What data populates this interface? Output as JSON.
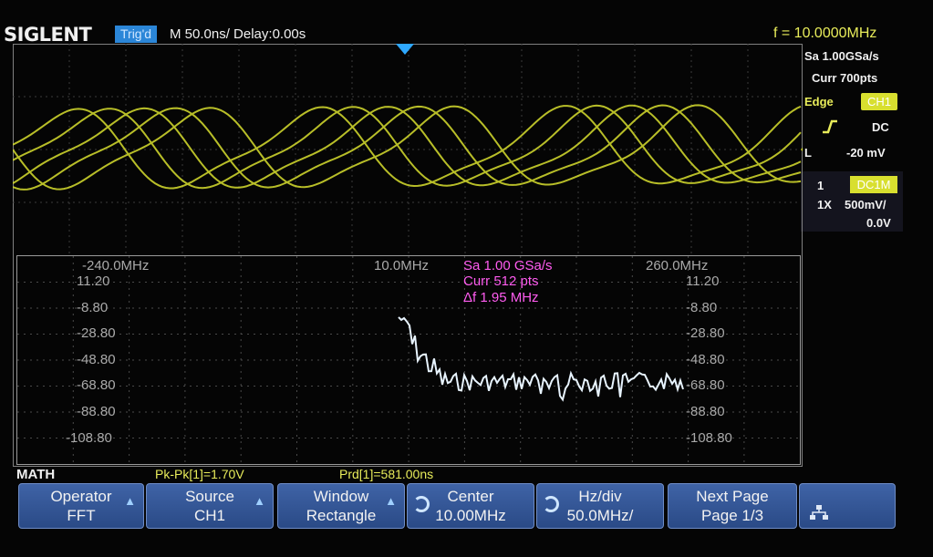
{
  "header": {
    "brand": "SIGLENT",
    "trigger_status": "Trig'd",
    "timebase": "M 50.0ns/",
    "delay": "Delay:0.00s",
    "frequency": "f = 10.0000MHz"
  },
  "acquisition": {
    "sample_rate": "Sa 1.00GSa/s",
    "current_points": "Curr 700pts"
  },
  "trigger": {
    "type": "Edge",
    "source": "CH1",
    "slope_icon": "rising-edge-icon",
    "coupling": "DC",
    "level_label": "L",
    "level_value": "-20 mV"
  },
  "channel1": {
    "number": "1",
    "coupling": "DC1M",
    "probe": "1X",
    "scale": "500mV/",
    "offset": "0.0V",
    "color": "#d8df2f"
  },
  "fft": {
    "left_freq": "-240.0MHz",
    "center_freq": "10.0MHz",
    "right_freq": "260.0MHz",
    "info_sample_rate": "Sa 1.00 GSa/s",
    "info_points": "Curr 512 pts",
    "info_delta_f": "Δf 1.95 MHz",
    "y_labels": [
      "11.20",
      "-8.80",
      "-28.80",
      "-48.80",
      "-68.80",
      "-88.80",
      "-108.80"
    ],
    "info_color": "#ff5cf0",
    "trace_color": "#e8f4ff"
  },
  "math_status": {
    "label": "MATH",
    "pkpk": "Pk-Pk[1]=1.70V",
    "period": "Prd[1]=581.00ns"
  },
  "softkeys": [
    {
      "line1": "Operator",
      "line2": "FFT"
    },
    {
      "line1": "Source",
      "line2": "CH1"
    },
    {
      "line1": "Window",
      "line2": "Rectangle"
    },
    {
      "line1": "Center",
      "line2": "10.00MHz"
    },
    {
      "line1": "Hz/div",
      "line2": "50.0MHz/"
    },
    {
      "line1": "Next Page",
      "line2": "Page 1/3"
    }
  ],
  "icons": {
    "trigger_position": "trigger-position-marker-icon",
    "network": "network-icon"
  }
}
